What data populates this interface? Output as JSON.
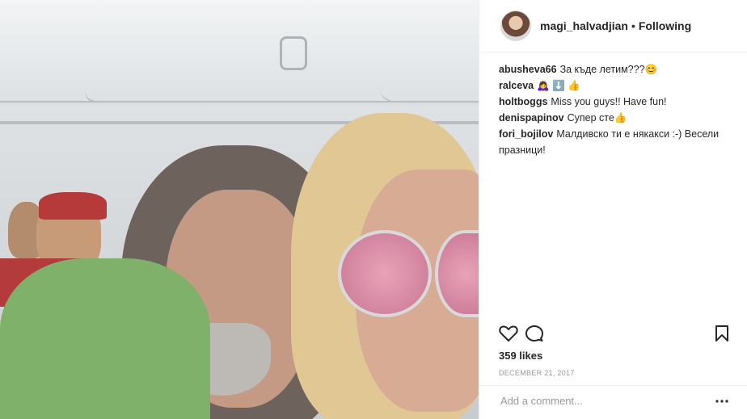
{
  "post": {
    "author": "magi_halvadjian",
    "separator": "•",
    "follow_status": "Following"
  },
  "comments": [
    {
      "user": "abusheva66",
      "text": "За къде летим???😊"
    },
    {
      "user": "ralceva",
      "text": "🙇‍♀️ ⬇️ 👍"
    },
    {
      "user": "holtboggs",
      "text": "Miss you guys!! Have fun!"
    },
    {
      "user": "denispapinov",
      "text": "Супер сте👍"
    },
    {
      "user": "fori_bojilov",
      "text": "Малдивско ти е някакси :-) Весели празници!"
    }
  ],
  "actions": {
    "like_icon": "heart-icon",
    "comment_icon": "comment-bubble-icon",
    "save_icon": "bookmark-icon",
    "more_icon": "ellipsis-icon"
  },
  "likes": "359 likes",
  "date": "DECEMBER 21, 2017",
  "add_comment_placeholder": "Add a comment...",
  "colors": {
    "text": "#262626",
    "muted": "#999999",
    "border": "#efefef"
  }
}
